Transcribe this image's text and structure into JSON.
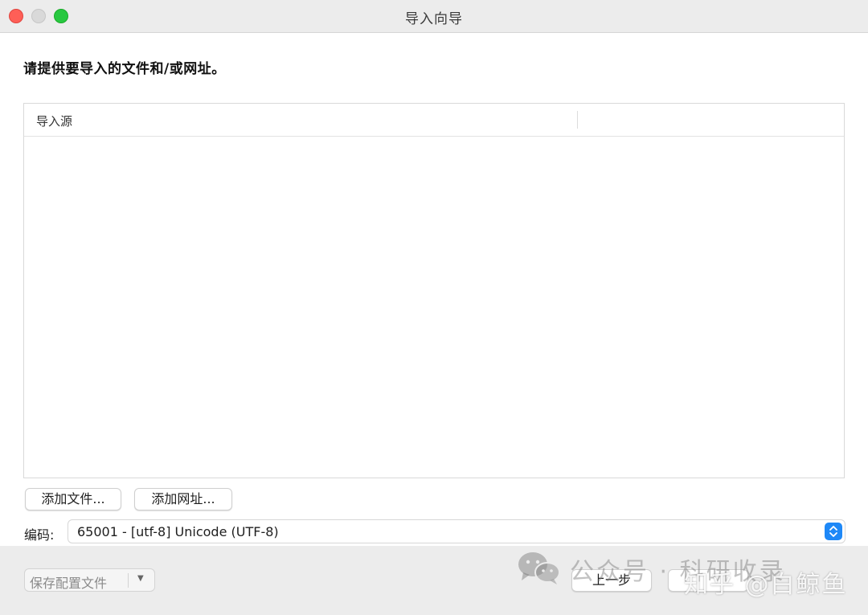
{
  "window": {
    "title": "导入向导"
  },
  "main": {
    "instruction": "请提供要导入的文件和/或网址。",
    "table": {
      "columns": [
        "导入源",
        ""
      ]
    },
    "buttons": {
      "add_file": "添加文件...",
      "add_url": "添加网址..."
    },
    "encoding": {
      "label": "编码:",
      "value": "65001 - [utf-8] Unicode (UTF-8)"
    }
  },
  "footer": {
    "save_config": "保存配置文件",
    "back": "上一步",
    "next": ""
  },
  "watermark": {
    "text": "公众号 · 科研收录",
    "zhihu": "知乎 @白鲸鱼"
  },
  "colors": {
    "close": "#fe5f57",
    "minimize": "#d9d9d9",
    "zoom": "#28c840",
    "accent": "#1e88f7"
  }
}
